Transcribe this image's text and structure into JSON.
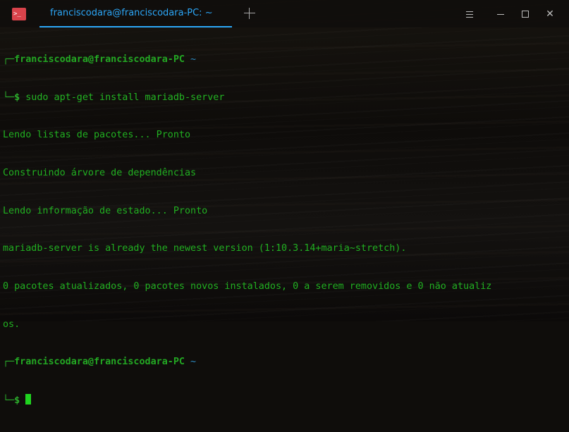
{
  "window": {
    "tab_title": "franciscodara@franciscodara-PC: ~",
    "app_icon_glyph": ">_",
    "close_glyph": "✕"
  },
  "terminal": {
    "prompt1": {
      "frame_top": "┌─",
      "user_host": "franciscodara@franciscodara-PC",
      "path": "~",
      "frame_bottom": "└─",
      "symbol": "$",
      "command": "sudo apt-get install mariadb-server"
    },
    "output": [
      "Lendo listas de pacotes... Pronto",
      "Construindo árvore de dependências",
      "Lendo informação de estado... Pronto",
      "mariadb-server is already the newest version (1:10.3.14+maria~stretch).",
      "0 pacotes atualizados, 0 pacotes novos instalados, 0 a serem removidos e 0 não atualiz",
      "os."
    ],
    "prompt2": {
      "frame_top": "┌─",
      "user_host": "franciscodara@franciscodara-PC",
      "path": "~",
      "frame_bottom": "└─",
      "symbol": "$"
    }
  },
  "colors": {
    "accent_blue": "#2ca7f8",
    "terminal_green": "#26b926",
    "close_red_icon": "#d9434b"
  }
}
